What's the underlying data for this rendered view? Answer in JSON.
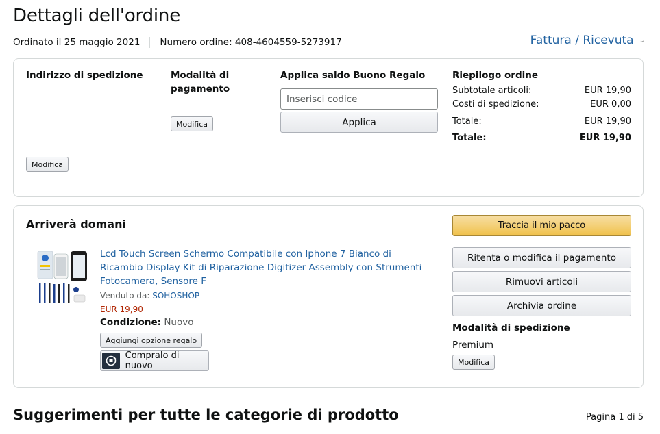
{
  "page": {
    "title": "Dettagli dell'ordine",
    "ordered_on": "Ordinato il 25 maggio 2021",
    "order_number": "Numero ordine: 408-4604559-5273917",
    "invoice_link": "Fattura / Ricevuta"
  },
  "summary_box": {
    "shipping_address_title": "Indirizzo di spedizione",
    "shipping_modify": "Modifica",
    "payment_title": "Modalità di pagamento",
    "payment_modify": "Modifica",
    "gift_title": "Applica saldo Buono Regalo",
    "gift_placeholder": "Inserisci codice",
    "gift_apply": "Applica",
    "order_summary_title": "Riepilogo ordine",
    "rows": [
      {
        "label": "Subtotale articoli:",
        "value": "EUR 19,90"
      },
      {
        "label": "Costi di spedizione:",
        "value": "EUR 0,00"
      },
      {
        "label": "Totale:",
        "value": "EUR 19,90"
      },
      {
        "label": "Totale:",
        "value": "EUR 19,90"
      }
    ]
  },
  "shipment": {
    "arrival": "Arriverà domani",
    "product_title": "Lcd Touch Screen Schermo Compatibile con Iphone 7 Bianco di Ricambio Display Kit di Riparazione Digitizer Assembly con Strumenti Fotocamera, Sensore F",
    "sold_by_label": "Venduto da:",
    "seller": "SOHOSHOP",
    "price": "EUR 19,90",
    "condition_label": "Condizione:",
    "condition_value": "Nuovo",
    "gift_option": "Aggiungi opzione regalo",
    "buy_again": "Compralo di nuovo",
    "actions": {
      "track": "Traccia il mio pacco",
      "retry_payment": "Ritenta o modifica il pagamento",
      "remove_items": "Rimuovi articoli",
      "archive": "Archivia ordine"
    },
    "shipping_method_title": "Modalità di spedizione",
    "shipping_method": "Premium",
    "shipping_modify": "Modifica"
  },
  "suggestions": {
    "title": "Suggerimenti per tutte le categorie di prodotto",
    "pager": "Pagina 1 di 5"
  },
  "colors": {
    "link": "#2162a1",
    "price": "#b12704",
    "primary_button": "#f0c14b",
    "border": "#d5d9d9"
  }
}
